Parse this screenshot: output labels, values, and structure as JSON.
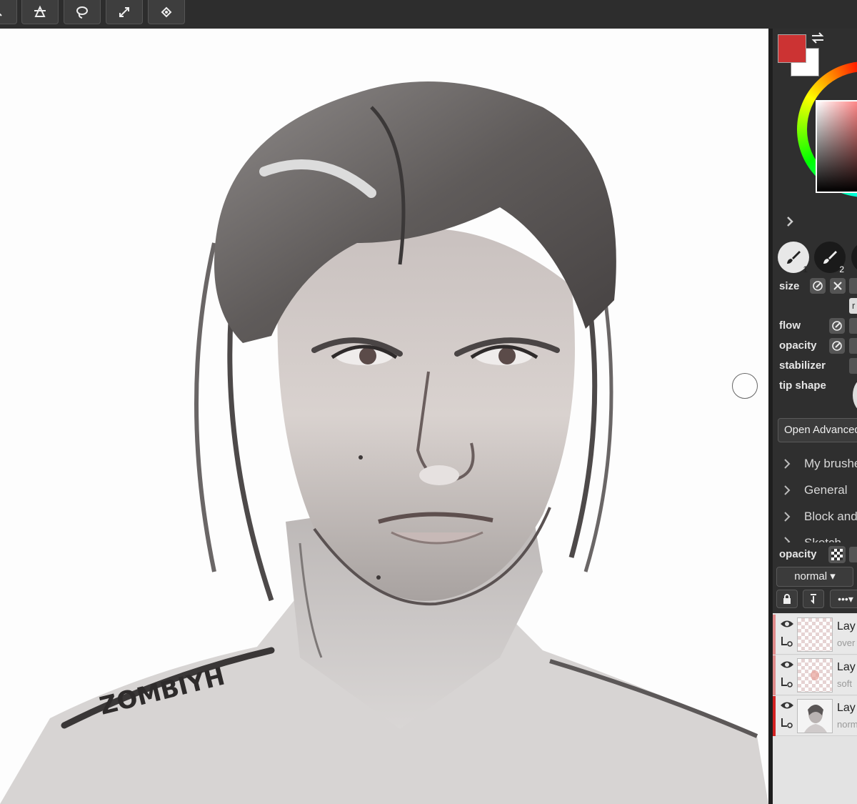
{
  "toolbar": {
    "buttons": [
      {
        "icon": "zoom-icon"
      },
      {
        "icon": "transform-icon"
      },
      {
        "icon": "lasso-icon"
      },
      {
        "icon": "fullscreen-icon"
      },
      {
        "icon": "fill-icon"
      }
    ]
  },
  "colors": {
    "primary": "#cc3333",
    "secondary": "#ffffff"
  },
  "brush_slots": [
    {
      "number": "1",
      "active": true
    },
    {
      "number": "2",
      "active": false
    }
  ],
  "brush_props": {
    "size_label": "size",
    "flow_label": "flow",
    "opacity_label": "opacity",
    "stabilizer_label": "stabilizer",
    "tip_shape_label": "tip shape",
    "size_field_partial": "r"
  },
  "open_advanced_label": "Open Advanced",
  "brush_categories": [
    {
      "label": "My brushe"
    },
    {
      "label": "General"
    },
    {
      "label": "Block and"
    },
    {
      "label": "Sketch"
    }
  ],
  "layer_panel": {
    "opacity_label": "opacity",
    "blend_mode": "normal",
    "more_label": "•••"
  },
  "layers": [
    {
      "name": "Lay",
      "mode": "over",
      "marker": "#e08a8a"
    },
    {
      "name": "Lay",
      "mode": "soft",
      "marker": "#e08a8a"
    },
    {
      "name": "Lay",
      "mode": "norm",
      "marker": "#d42323"
    }
  ],
  "signature": "ZOMBIYH"
}
